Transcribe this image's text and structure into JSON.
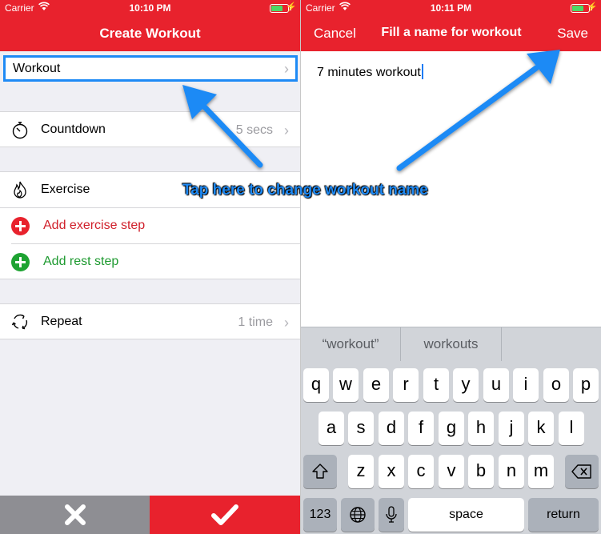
{
  "left_screen": {
    "status": {
      "carrier": "Carrier",
      "time": "10:10 PM"
    },
    "nav": {
      "title": "Create Workout"
    },
    "workout_row": {
      "label": "Workout",
      "chevron": "›"
    },
    "countdown": {
      "label": "Countdown",
      "value": "5 secs",
      "chevron": "›",
      "icon": "stopwatch-icon"
    },
    "exercise": {
      "label": "Exercise",
      "icon": "flame-icon"
    },
    "add_exercise": {
      "label": "Add exercise step",
      "color": "#e8222d"
    },
    "add_rest": {
      "label": "Add rest step",
      "color": "#1ea332"
    },
    "repeat": {
      "label": "Repeat",
      "value": "1 time",
      "chevron": "›",
      "icon": "repeat-icon"
    },
    "bottom": {
      "cancel_icon": "close-icon",
      "confirm_icon": "checkmark-icon",
      "cancel_color": "#8e8e93",
      "confirm_color": "#e8222d"
    }
  },
  "right_screen": {
    "status": {
      "carrier": "Carrier",
      "time": "10:11 PM"
    },
    "nav": {
      "left": "Cancel",
      "title": "Fill a name for workout",
      "right": "Save"
    },
    "text_value": "7 minutes workout",
    "suggestions": [
      "“workout”",
      "workouts",
      ""
    ],
    "keys": {
      "row1": [
        "q",
        "w",
        "e",
        "r",
        "t",
        "y",
        "u",
        "i",
        "o",
        "p"
      ],
      "row2": [
        "a",
        "s",
        "d",
        "f",
        "g",
        "h",
        "j",
        "k",
        "l"
      ],
      "row3": [
        "z",
        "x",
        "c",
        "v",
        "b",
        "n",
        "m"
      ],
      "num": "123",
      "space": "space",
      "return": "return"
    }
  },
  "annotation": {
    "text": "Tap here to change workout name",
    "color": "#1e8af5"
  },
  "colors": {
    "accent": "#e8222d",
    "arrow": "#1e8af5"
  }
}
